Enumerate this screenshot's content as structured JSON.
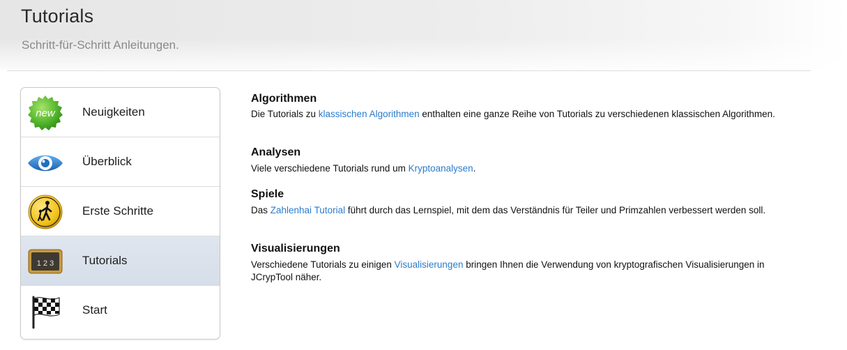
{
  "header": {
    "title": "Tutorials",
    "subtitle": "Schritt-für-Schritt Anleitungen."
  },
  "sidebar": {
    "items": [
      {
        "label": "Neuigkeiten",
        "icon": "new-badge-icon",
        "active": false
      },
      {
        "label": "Überblick",
        "icon": "eye-icon",
        "active": false
      },
      {
        "label": "Erste Schritte",
        "icon": "pedestrian-sign-icon",
        "active": false
      },
      {
        "label": "Tutorials",
        "icon": "chalkboard-icon",
        "active": true
      },
      {
        "label": "Start",
        "icon": "checkered-flag-icon",
        "active": false
      }
    ],
    "new_badge_text": "new",
    "chalkboard_text": "1 2 3"
  },
  "sections": [
    {
      "heading": "Algorithmen",
      "text_before": "Die Tutorials zu ",
      "link": "klassischen Algorithmen",
      "text_after": " enthalten eine ganze Reihe von Tutorials zu verschiedenen klassischen Algorithmen."
    },
    {
      "heading": "Analysen",
      "text_before": "Viele verschiedene Tutorials rund um ",
      "link": "Kryptoanalysen",
      "text_after": "."
    },
    {
      "heading": "Spiele",
      "text_before": "Das ",
      "link": "Zahlenhai Tutorial",
      "text_after": " führt durch das Lernspiel, mit dem das Verständnis für Teiler und Primzahlen verbessert werden soll."
    },
    {
      "heading": "Visualisierungen",
      "text_before": "Verschiedene Tutorials zu einigen ",
      "link": "Visualisierungen",
      "text_after": " bringen Ihnen die Verwendung von kryptografischen Visualisierungen in JCrypTool näher."
    }
  ],
  "colors": {
    "link": "#2a7ccc",
    "active_nav": "#d9e1ec",
    "badge_green": "#4caf2a",
    "eye_blue": "#2f7fd0",
    "sign_yellow": "#f2c21a"
  }
}
